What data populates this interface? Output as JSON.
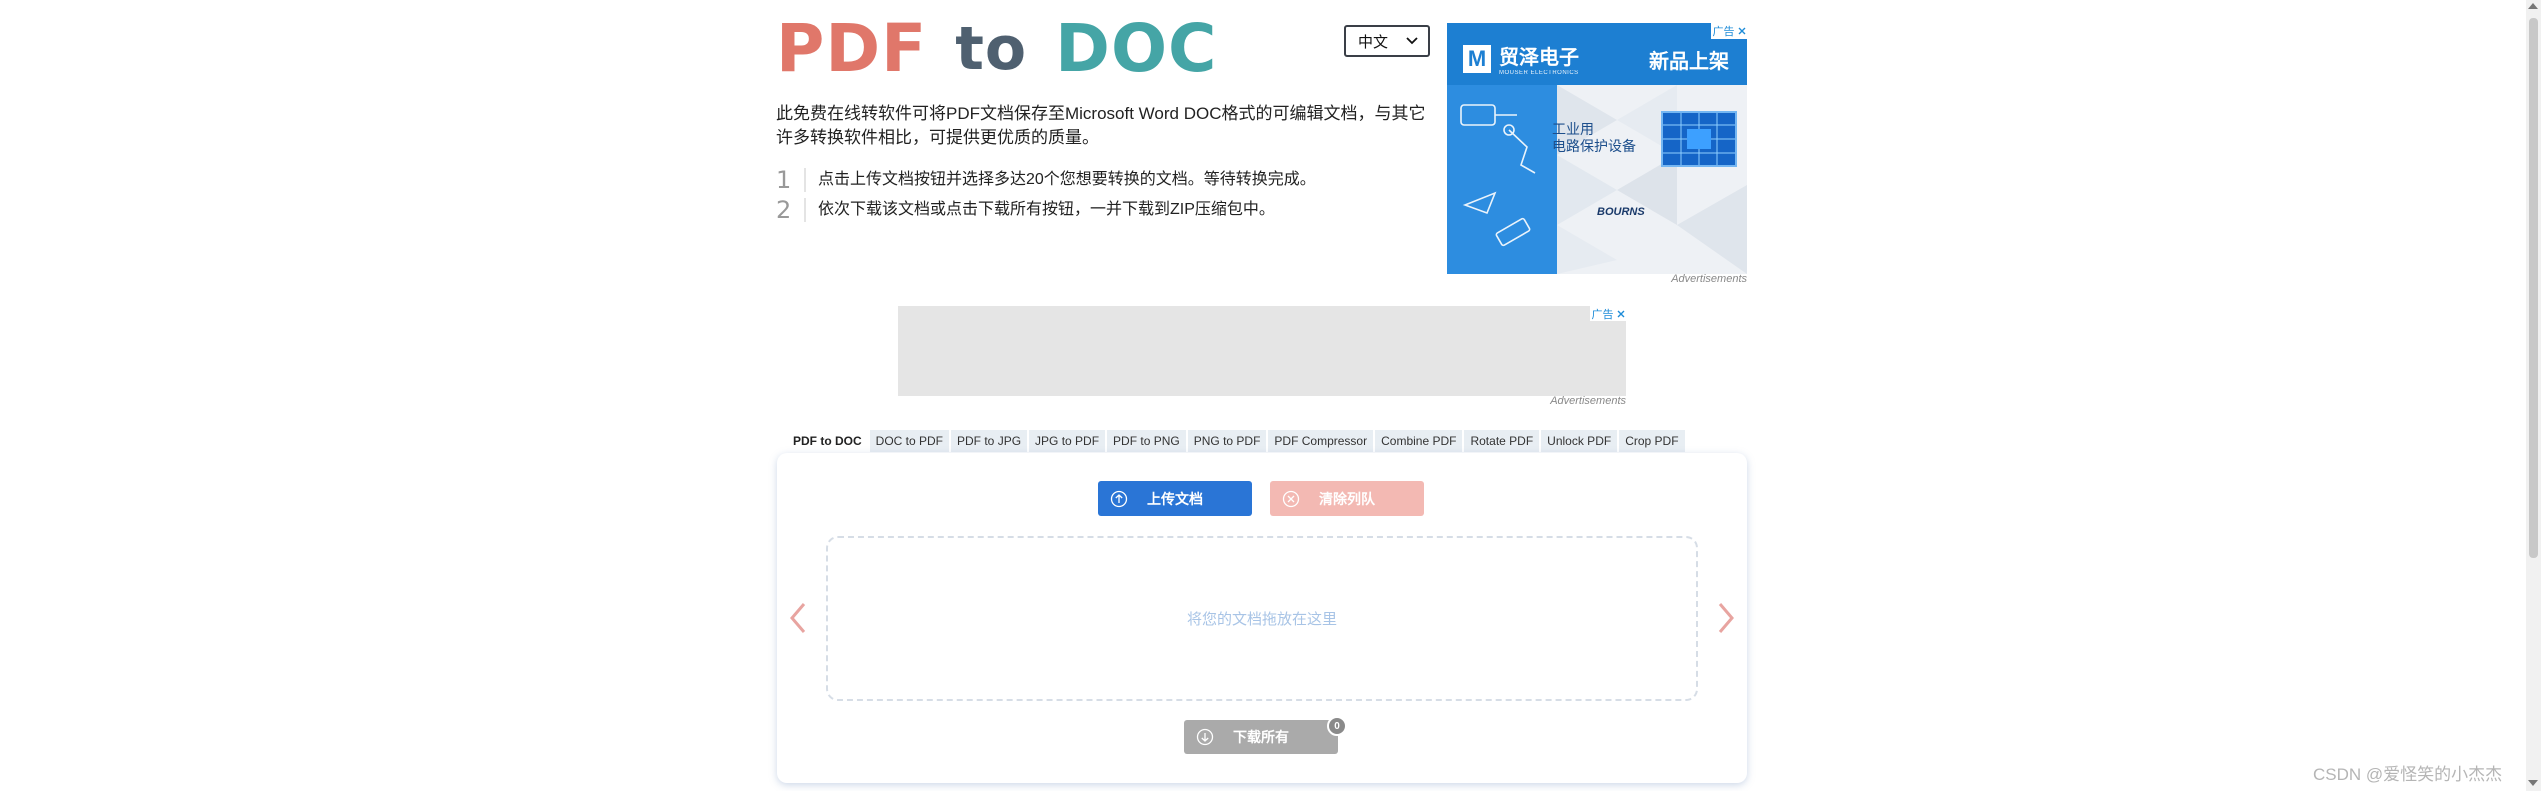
{
  "logo": {
    "part1": "PDF",
    "part2": "to",
    "part3": "DOC",
    "color1": "#e0776a",
    "color2": "#4f6070",
    "color3": "#45a5a6"
  },
  "language": {
    "selected": "中文"
  },
  "description": "此免费在线转软件可将PDF文档保存至Microsoft Word DOC格式的可编辑文档，与其它许多转换软件相比，可提供更优质的质量。",
  "steps": [
    {
      "num": "1",
      "text": "点击上传文档按钮并选择多达20个您想要转换的文档。等待转换完成。"
    },
    {
      "num": "2",
      "text": "依次下载该文档或点击下载所有按钮，一并下载到ZIP压缩包中。"
    }
  ],
  "ads": {
    "tag_label": "广告",
    "label": "Advertisements",
    "right": {
      "brand_m": "M",
      "brand_cn": "贸泽电子",
      "brand_en": "MOUSER ELECTRONICS",
      "headline": "新品上架",
      "line1": "工业用",
      "line2": "电路保护设备",
      "sponsor": "BOURNS"
    }
  },
  "tabs": [
    {
      "label": "PDF to DOC",
      "active": true
    },
    {
      "label": "DOC to PDF"
    },
    {
      "label": "PDF to JPG"
    },
    {
      "label": "JPG to PDF"
    },
    {
      "label": "PDF to PNG"
    },
    {
      "label": "PNG to PDF"
    },
    {
      "label": "PDF Compressor"
    },
    {
      "label": "Combine PDF"
    },
    {
      "label": "Rotate PDF"
    },
    {
      "label": "Unlock PDF"
    },
    {
      "label": "Crop PDF"
    }
  ],
  "converter": {
    "upload_label": "上传文档",
    "clear_label": "清除列队",
    "drop_label": "将您的文档拖放在这里",
    "download_label": "下载所有",
    "download_count": "0"
  },
  "watermark": "CSDN @爱怪笑的小杰杰",
  "colors": {
    "primary": "#2a75d6",
    "clear": "#f3b9b3",
    "disabled": "#aaaaaa",
    "arrow": "#e8a4a0"
  }
}
